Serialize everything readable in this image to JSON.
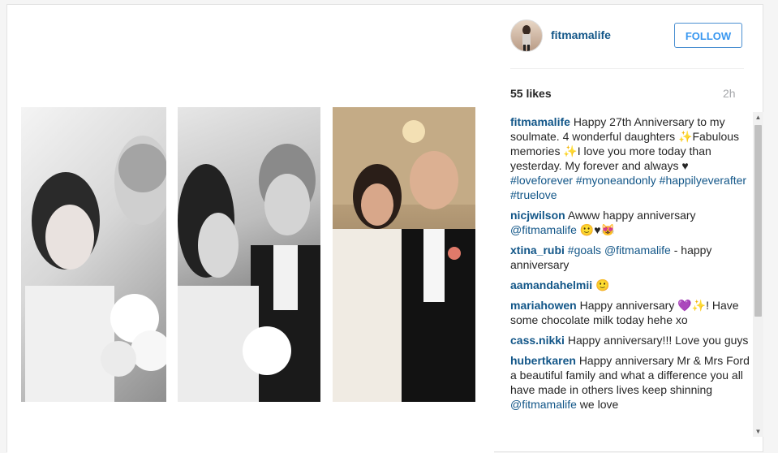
{
  "post": {
    "username": "fitmamalife",
    "follow_label": "FOLLOW",
    "likes": "55 likes",
    "time": "2h"
  },
  "comments": [
    {
      "user": "fitmamalife",
      "text": "Happy 27th Anniversary to my soulmate. 4 wonderful daughters ✨Fabulous memories ✨I love you more today than yesterday. My forever and always ♥",
      "tags": "#loveforever #myoneandonly #happilyeverafter #truelove"
    },
    {
      "user": "nicjwilson",
      "text": "Awww happy anniversary",
      "tags": "@fitmamalife",
      "suffix": "🙂♥😻"
    },
    {
      "user": "xtina_rubi",
      "tags": "#goals @fitmamalife",
      "text": "- happy anniversary"
    },
    {
      "user": "aamandahelmii",
      "text": "🙂"
    },
    {
      "user": "mariahowen",
      "text": "Happy anniversary 💜✨! Have some chocolate milk today hehe xo"
    },
    {
      "user": "cass.nikki",
      "text": "Happy anniversary!!! Love you guys"
    },
    {
      "user": "hubertkaren",
      "text": "Happy anniversary Mr & Mrs Ford a beautiful family and what a difference you all have made in others lives keep shinning",
      "tags": "@fitmamalife",
      "suffix": "we love"
    }
  ],
  "icons": {
    "scroll_up": "scroll-up-arrow-icon",
    "scroll_down": "scroll-down-arrow-icon"
  }
}
